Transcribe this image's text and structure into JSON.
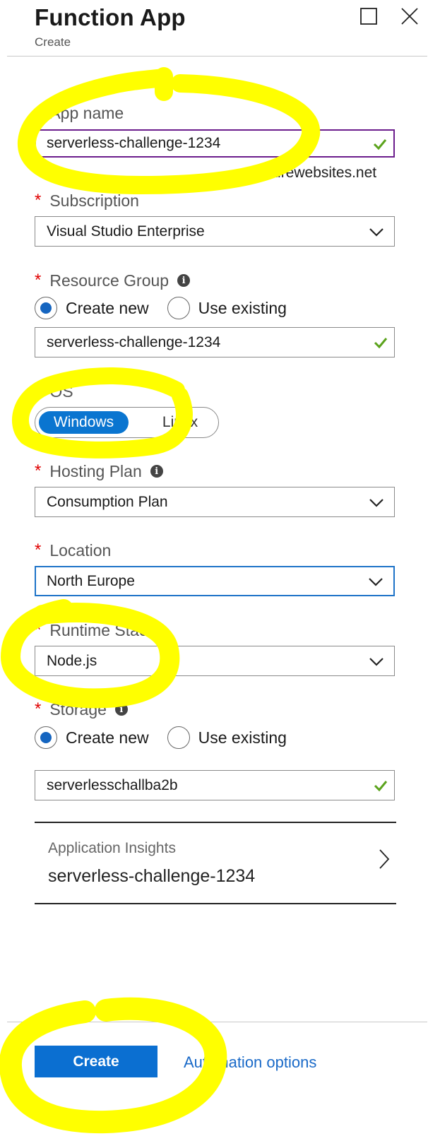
{
  "header": {
    "title": "Function App",
    "subtitle": "Create",
    "maximize_icon": "maximize-icon",
    "close_icon": "close-icon"
  },
  "fields": {
    "app_name": {
      "label": "App name",
      "value": "serverless-challenge-1234",
      "suffix": ".azurewebsites.net",
      "valid": true
    },
    "subscription": {
      "label": "Subscription",
      "value": "Visual Studio Enterprise"
    },
    "resource_group": {
      "label": "Resource Group",
      "options": [
        "Create new",
        "Use existing"
      ],
      "selected": "Create new",
      "value": "serverless-challenge-1234",
      "valid": true
    },
    "os": {
      "label": "OS",
      "options": [
        "Windows",
        "Linux"
      ],
      "selected": "Windows"
    },
    "hosting_plan": {
      "label": "Hosting Plan",
      "value": "Consumption Plan"
    },
    "location": {
      "label": "Location",
      "value": "North Europe"
    },
    "runtime_stack": {
      "label": "Runtime Stack",
      "value": "Node.js"
    },
    "storage": {
      "label": "Storage",
      "options": [
        "Create new",
        "Use existing"
      ],
      "selected": "Create new",
      "value": "serverlesschallba2b",
      "valid": true
    },
    "app_insights": {
      "label": "Application Insights",
      "value": "serverless-challenge-1234"
    }
  },
  "required_marker": "*",
  "footer": {
    "create_label": "Create",
    "automation_label": "Automation options"
  },
  "colors": {
    "accent": "#0b6fd1",
    "required": "#e00000",
    "valid": "#5ba31c",
    "highlight": "#ffff00",
    "focus_purple": "#6b1d8c"
  }
}
